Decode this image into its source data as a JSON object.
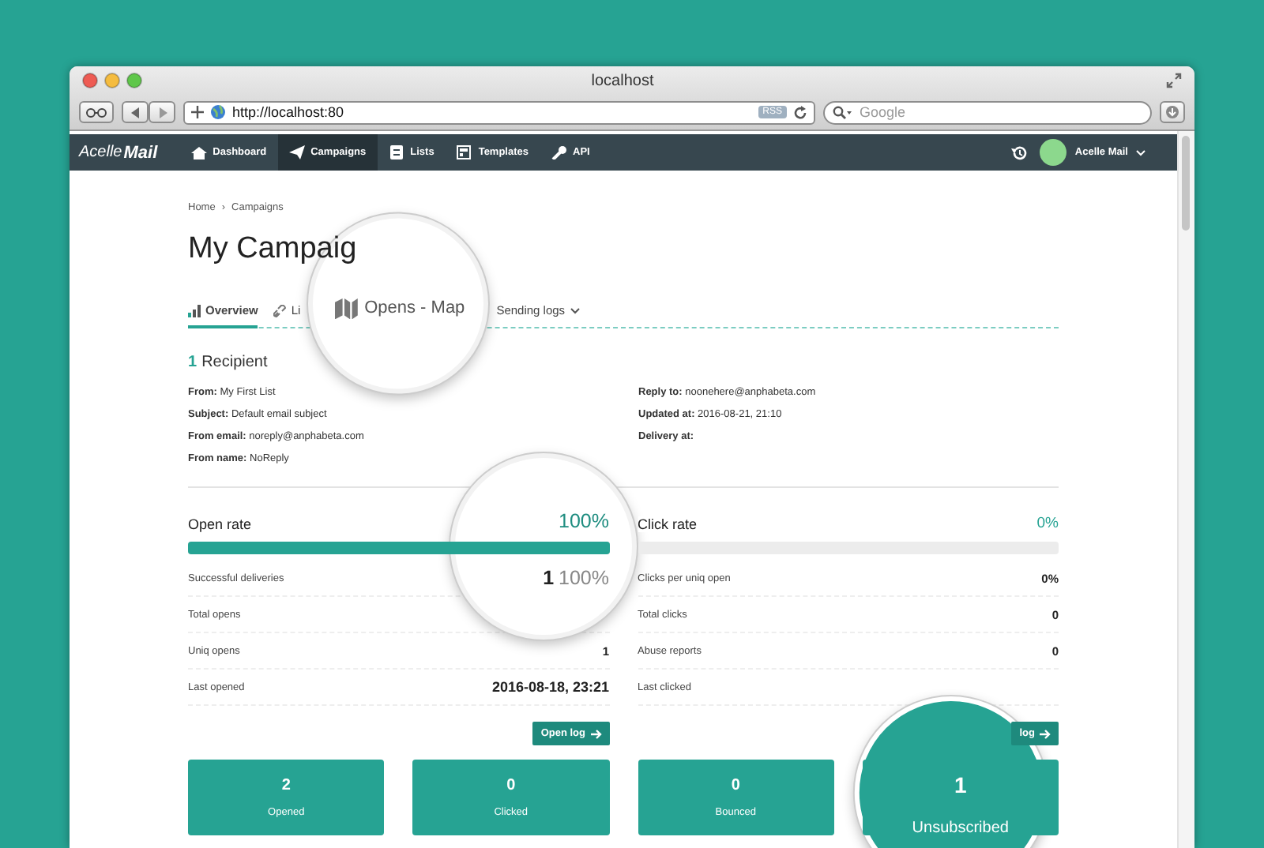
{
  "browser": {
    "title": "localhost",
    "url": "http://localhost:80",
    "rss": "RSS",
    "search_placeholder": "Google"
  },
  "nav": {
    "logo": [
      "Acelle",
      "Mail"
    ],
    "user": "Acelle Mail",
    "items": [
      {
        "label": "Dashboard",
        "kind": "home",
        "selected": false
      },
      {
        "label": "Campaigns",
        "kind": "plane",
        "selected": true
      },
      {
        "label": "Lists",
        "kind": "list",
        "selected": false
      },
      {
        "label": "Templates",
        "kind": "template",
        "selected": false
      },
      {
        "label": "API",
        "kind": "key",
        "selected": false
      }
    ]
  },
  "breadcrumb": {
    "items": [
      "Home",
      "Campaigns"
    ],
    "separator": "›"
  },
  "title": "My Campaig",
  "tabs": [
    {
      "label": "Overview",
      "kind": "chart",
      "selected": true,
      "magnified": false
    },
    {
      "label": "Li",
      "kind": "link",
      "selected": false,
      "magnified": false
    },
    {
      "label": "Opens - Map",
      "kind": "map",
      "selected": false,
      "magnified": true
    },
    {
      "label": "Sending logs",
      "kind": "dropdown",
      "selected": false,
      "magnified": false
    }
  ],
  "recipients": {
    "count": "1",
    "label": "Recipient"
  },
  "details_left": [
    {
      "label": "From:",
      "value": "My First List"
    },
    {
      "label": "Subject:",
      "value": "Default email subject"
    },
    {
      "label": "From email:",
      "value": "noreply@anphabeta.com"
    },
    {
      "label": "From name:",
      "value": "NoReply"
    }
  ],
  "details_right": [
    {
      "label": "Reply to:",
      "value": "noonehere@anphabeta.com"
    },
    {
      "label": "Updated at:",
      "value": "2016-08-21, 21:10"
    },
    {
      "label": "Delivery at:"
    }
  ],
  "panels": [
    {
      "title": "Open rate",
      "reading": "100%",
      "level": 1,
      "magnified": true,
      "button": "Open log",
      "rows": [
        {
          "label": "Successful deliveries",
          "value": "1",
          "share": "100%"
        },
        {
          "label": "Total opens"
        },
        {
          "label": "Uniq opens",
          "value": "1"
        },
        {
          "label": "Last opened",
          "value": "2016-08-18, 23:21"
        }
      ]
    },
    {
      "title": "Click rate",
      "reading": "0%",
      "level": 0,
      "magnified": false,
      "button": "log",
      "rows": [
        {
          "label": "Clicks per uniq open",
          "value": "0%"
        },
        {
          "label": "Total clicks",
          "value": "0"
        },
        {
          "label": "Abuse reports",
          "value": "0"
        },
        {
          "label": "Last clicked"
        }
      ]
    }
  ],
  "stats": [
    {
      "value": "2",
      "label": "Opened",
      "magnified": false
    },
    {
      "value": "0",
      "label": "Clicked",
      "magnified": false
    },
    {
      "value": "0",
      "label": "Bounced",
      "magnified": false
    },
    {
      "value": "1",
      "label": "Unsubscribed",
      "magnified": true
    }
  ]
}
